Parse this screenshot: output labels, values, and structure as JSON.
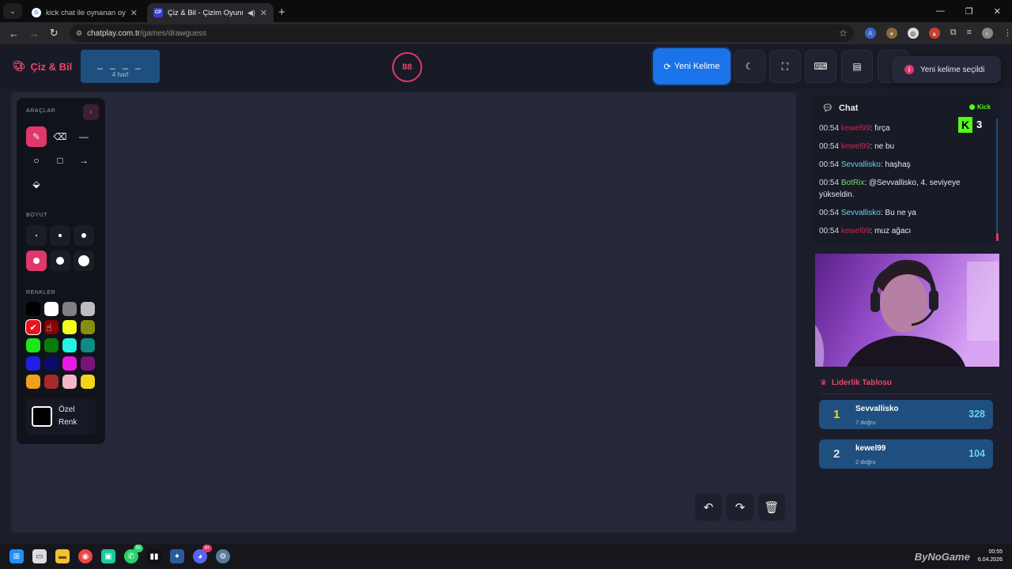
{
  "browser": {
    "tabs": [
      {
        "label": "kick chat ile oynanan oyunlar -",
        "active": false
      },
      {
        "label": "Çiz & Bil - Çizim Oyunu",
        "active": true
      }
    ],
    "url_host": "chatplay.com.tr",
    "url_path": "/games/drawguess"
  },
  "header": {
    "brand": "Çiz & Bil",
    "word_blanks": "_ _ _ _",
    "word_hint": "4 harf",
    "timer": "88",
    "new_word_label": "Yeni Kelime",
    "toast_text": "Yeni kelime seçildi",
    "toast_icon_text": "i"
  },
  "tools": {
    "section_tools": "ARAÇLAR",
    "section_size": "BOYUT",
    "section_colors": "RENKLER",
    "custom_color_line1": "Özel",
    "custom_color_line2": "Renk",
    "sizes": [
      2,
      4,
      6,
      8,
      10,
      14
    ],
    "active_size_index": 3,
    "colors": [
      "#000000",
      "#ffffff",
      "#808080",
      "#bdbdbd",
      "#e8141c",
      "#8b0000",
      "#f2ff1a",
      "#858f0f",
      "#1ee51e",
      "#0a7a0a",
      "#23f4e6",
      "#0f8a85",
      "#1f1fe8",
      "#0b0b6e",
      "#e818e8",
      "#7a127a",
      "#f0a01a",
      "#a52a2a",
      "#f2b8c8",
      "#f2d41a"
    ],
    "selected_color_index": 4
  },
  "chat": {
    "title": "Chat",
    "platform": "Kick",
    "counter": "3",
    "messages": [
      {
        "time": "00:54",
        "user": "kewel99",
        "user_class": "kewel",
        "text": ": fırça"
      },
      {
        "time": "00:54",
        "user": "kewel99",
        "user_class": "kewel",
        "text": ": ne bu"
      },
      {
        "time": "00:54",
        "user": "Sevvallisko",
        "user_class": "sevval",
        "text": ": haşhaş"
      },
      {
        "time": "00:54",
        "user": "BotRix",
        "user_class": "botrix",
        "text": ": @Sevvallisko, 4. seviyeye yükseldin."
      },
      {
        "time": "00:54",
        "user": "Sevvallisko",
        "user_class": "sevval",
        "text": ": Bu ne ya"
      },
      {
        "time": "00:54",
        "user": "kewel99",
        "user_class": "kewel",
        "text": ": muz ağacı"
      }
    ]
  },
  "leaderboard": {
    "title": "Liderlik Tablosu",
    "rows": [
      {
        "rank": "1",
        "name": "Sevvallisko",
        "sub": "7 doğru",
        "score": "328",
        "rank_color": "#f5d21c"
      },
      {
        "rank": "2",
        "name": "kewel99",
        "sub": "2 doğru",
        "score": "104",
        "rank_color": "#d8dde6"
      }
    ]
  },
  "taskbar": {
    "whatsapp_badge": "55",
    "discord_badge": "9+",
    "watermark": "ByNoGame",
    "clock_time": "00:55",
    "clock_date": "6.04.2026"
  }
}
